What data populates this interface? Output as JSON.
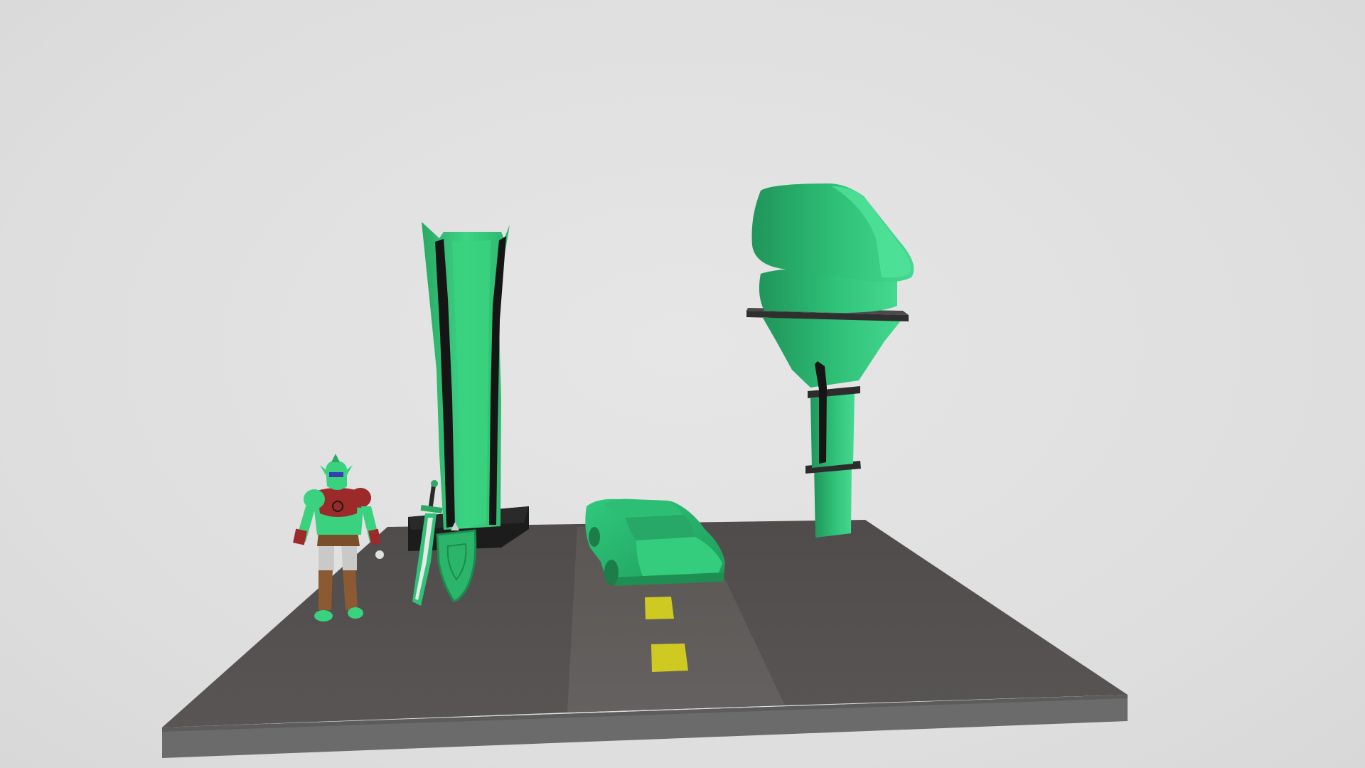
{
  "scene": {
    "background_color": "#e0e0e0",
    "ground_color": "#545150",
    "ground_edge_color": "#6b6b6b",
    "road_color": "#605c5a",
    "lane_marking_color": "#cfca21",
    "model_green": "#3ad27f",
    "model_green_dark": "#24a05c",
    "accent_black": "#141414",
    "armor_red": "#9c2a2a",
    "objects": [
      "character-figure",
      "sword",
      "shield",
      "tall-green-tower",
      "green-car",
      "mushroom-tower"
    ]
  }
}
